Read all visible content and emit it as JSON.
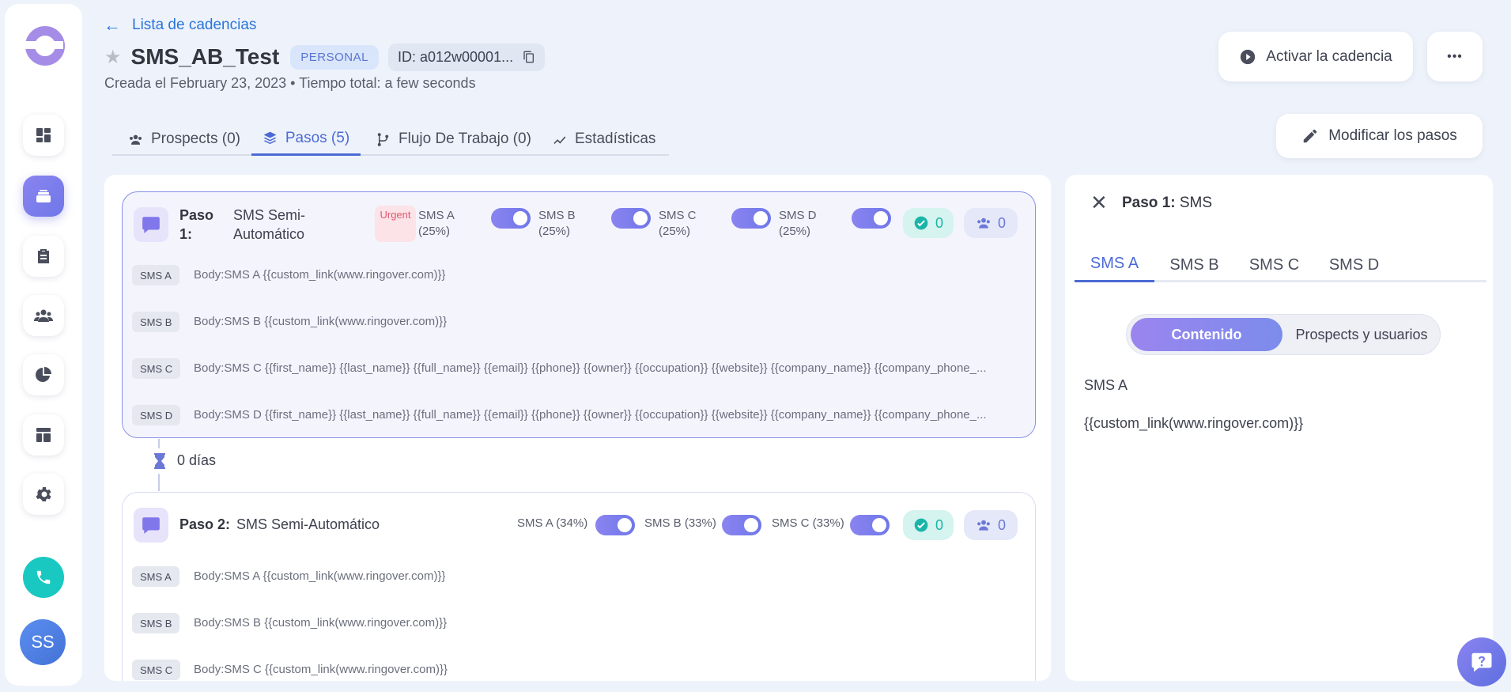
{
  "header": {
    "back_label": "Lista de cadencias",
    "title": "SMS_AB_Test",
    "badge": "PERSONAL",
    "id_label": "ID: a012w00001...",
    "subtitle": "Creada el February 23, 2023 • Tiempo total: a few seconds",
    "activate_label": "Activar la cadencia",
    "more_label": "•••",
    "modify_label": "Modificar los pasos"
  },
  "sidebar": {
    "avatar_initials": "SS",
    "items": [
      "dashboard-icon",
      "cadences-icon",
      "tasks-icon",
      "people-icon",
      "reports-icon",
      "templates-icon",
      "settings-icon"
    ]
  },
  "tabs": [
    {
      "label": "Prospects (0)",
      "icon": "people-icon"
    },
    {
      "label": "Pasos (5)",
      "icon": "layers-icon"
    },
    {
      "label": "Flujo De Trabajo (0)",
      "icon": "branch-icon"
    },
    {
      "label": "Estadísticas",
      "icon": "trend-icon"
    }
  ],
  "steps": [
    {
      "label": "Paso",
      "number": "1:",
      "name_line1": "SMS Semi-",
      "name_line2": "Automático",
      "urgent": "Urgent",
      "variants": [
        {
          "name": "SMS A",
          "pct": "(25%)"
        },
        {
          "name": "SMS B",
          "pct": "(25%)"
        },
        {
          "name": "SMS C",
          "pct": "(25%)"
        },
        {
          "name": "SMS D",
          "pct": "(25%)"
        }
      ],
      "done_count": "0",
      "people_count": "0",
      "bodies": [
        {
          "chip": "SMS A",
          "text": "Body:SMS A {{custom_link(www.ringover.com)}}"
        },
        {
          "chip": "SMS B",
          "text": "Body:SMS B {{custom_link(www.ringover.com)}}"
        },
        {
          "chip": "SMS C",
          "text": "Body:SMS C {{first_name}} {{last_name}} {{full_name}} {{email}} {{phone}} {{owner}} {{occupation}} {{website}} {{company_name}} {{company_phone_..."
        },
        {
          "chip": "SMS D",
          "text": "Body:SMS D {{first_name}} {{last_name}} {{full_name}} {{email}} {{phone}} {{owner}} {{occupation}} {{website}} {{company_name}} {{company_phone_..."
        }
      ]
    },
    {
      "label": "Paso 2:",
      "name": "SMS Semi-Automático",
      "variants": [
        {
          "label": "SMS A (34%)"
        },
        {
          "label": "SMS B (33%)"
        },
        {
          "label": "SMS C (33%)"
        }
      ],
      "done_count": "0",
      "people_count": "0",
      "bodies": [
        {
          "chip": "SMS A",
          "text": "Body:SMS A {{custom_link(www.ringover.com)}}"
        },
        {
          "chip": "SMS B",
          "text": "Body:SMS B {{custom_link(www.ringover.com)}}"
        },
        {
          "chip": "SMS C",
          "text": "Body:SMS C {{custom_link(www.ringover.com)}}"
        }
      ]
    }
  ],
  "delay": "0 días",
  "side_panel": {
    "title_bold": "Paso 1:",
    "title_rest": "SMS",
    "tabs": [
      "SMS A",
      "SMS B",
      "SMS C",
      "SMS D"
    ],
    "segment_active": "Contenido",
    "segment_inactive": "Prospects y usuarios",
    "content_title": "SMS A",
    "content_body": "{{custom_link(www.ringover.com)}}"
  },
  "colors": {
    "accent": "#4c6ad4",
    "toggle": "#7c7cec",
    "done": "#1ab5a8",
    "urgent": "#e0586e"
  }
}
